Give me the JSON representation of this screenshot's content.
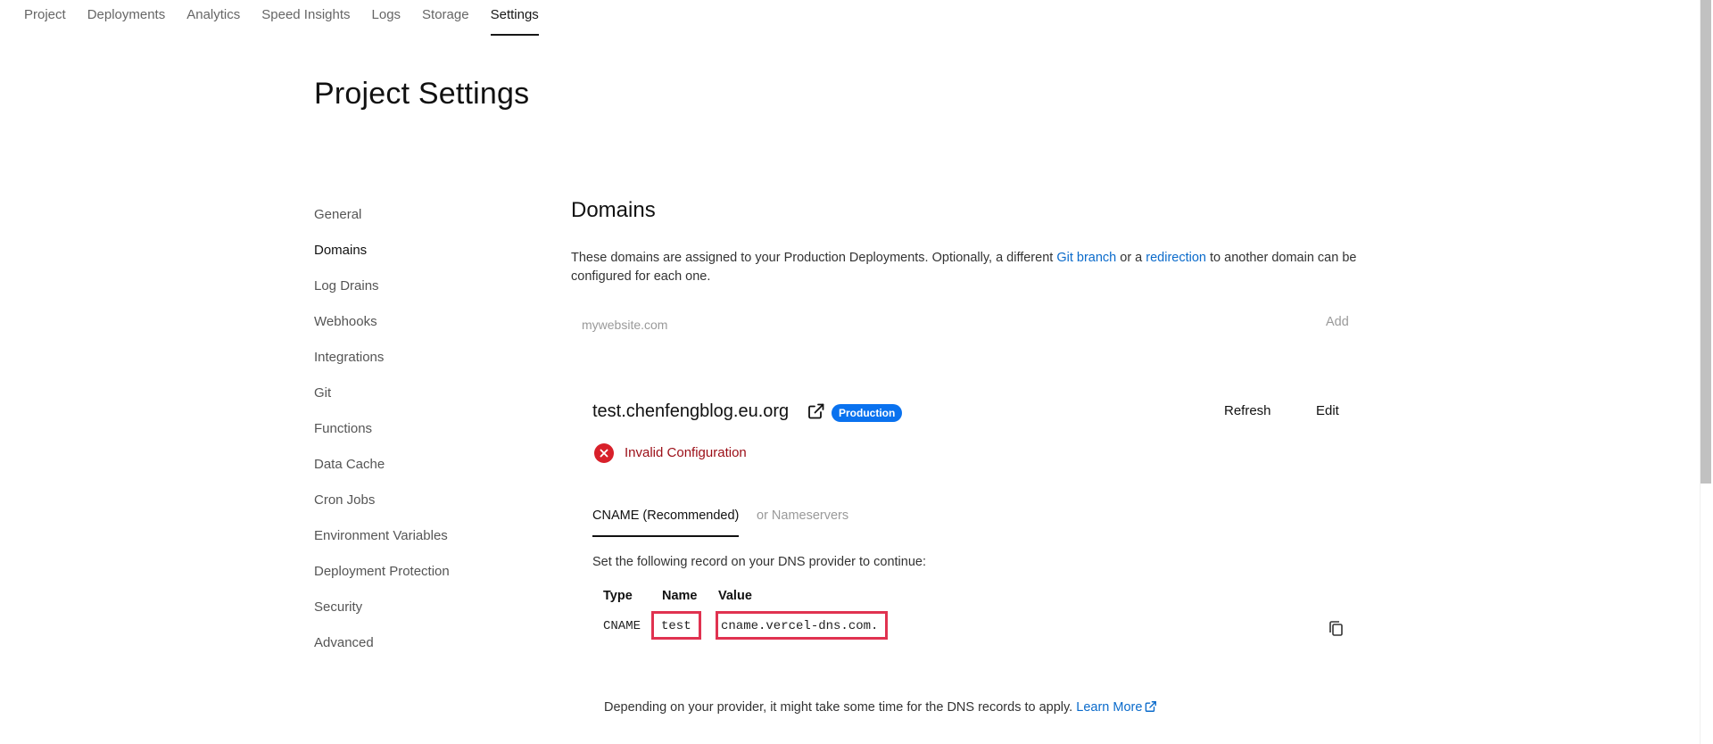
{
  "topnav": {
    "tabs": [
      {
        "label": "Project"
      },
      {
        "label": "Deployments"
      },
      {
        "label": "Analytics"
      },
      {
        "label": "Speed Insights"
      },
      {
        "label": "Logs"
      },
      {
        "label": "Storage"
      },
      {
        "label": "Settings",
        "active": true
      }
    ]
  },
  "page": {
    "title": "Project Settings"
  },
  "sidebar": {
    "items": [
      {
        "label": "General"
      },
      {
        "label": "Domains",
        "active": true
      },
      {
        "label": "Log Drains"
      },
      {
        "label": "Webhooks"
      },
      {
        "label": "Integrations"
      },
      {
        "label": "Git"
      },
      {
        "label": "Functions"
      },
      {
        "label": "Data Cache"
      },
      {
        "label": "Cron Jobs"
      },
      {
        "label": "Environment Variables"
      },
      {
        "label": "Deployment Protection"
      },
      {
        "label": "Security"
      },
      {
        "label": "Advanced"
      }
    ]
  },
  "domains": {
    "title": "Domains",
    "description": {
      "part1": "These domains are assigned to your Production Deployments. Optionally, a different ",
      "link1": "Git branch",
      "part2": " or a ",
      "link2": "redirection",
      "part3": " to another domain can be configured for each one."
    },
    "input_placeholder": "mywebsite.com",
    "input_value": "",
    "add_label": "Add"
  },
  "domain_card": {
    "name": "test.chenfengblog.eu.org",
    "badge": "Production",
    "refresh_label": "Refresh",
    "edit_label": "Edit",
    "status": {
      "text": "Invalid Configuration",
      "color": "#d8202a"
    },
    "tabs": {
      "active": "CNAME (Recommended)",
      "inactive": "or Nameservers"
    },
    "instructions": "Set the following record on your DNS provider to continue:",
    "record_table": {
      "headers": {
        "type": "Type",
        "name": "Name",
        "value": "Value"
      },
      "row": {
        "type": "CNAME",
        "name": "test",
        "value": "cname.vercel-dns.com."
      }
    },
    "note": {
      "text": "Depending on your provider, it might take some time for the DNS records to apply. ",
      "link": "Learn More"
    }
  },
  "colors": {
    "accent_link": "#0b6bcb",
    "badge_bg": "#0a72ef",
    "error": "#d8202a",
    "highlight_box": "#e03250"
  },
  "icons": {
    "external_link": "external-link-icon",
    "error_status": "error-x-icon",
    "copy": "copy-icon"
  }
}
